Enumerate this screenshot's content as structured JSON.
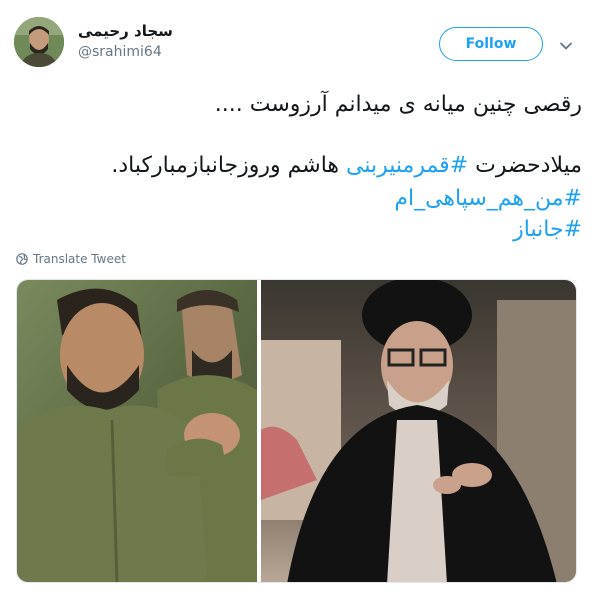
{
  "author": {
    "display_name": "سجاد رحیمی",
    "handle": "@srahimi64"
  },
  "actions": {
    "follow_label": "Follow"
  },
  "tweet": {
    "line1": "رقصی چنین میانه ی میدانم آرزوست ....",
    "line2_part1": "میلادحضرت",
    "line2_hashtag": "#قمرمنیربنی",
    "line2_part2": "هاشم وروزجانبازمبارکباد.",
    "hashtag2": "#من_هم_سپاهی_ام",
    "hashtag3": "#جانباز"
  },
  "translate": {
    "label": "Translate Tweet"
  },
  "colors": {
    "accent": "#1da1f2",
    "secondary_text": "#657786",
    "primary_text": "#14171a"
  },
  "icons": {
    "translate": "globe-icon",
    "caret": "chevron-down-icon"
  }
}
